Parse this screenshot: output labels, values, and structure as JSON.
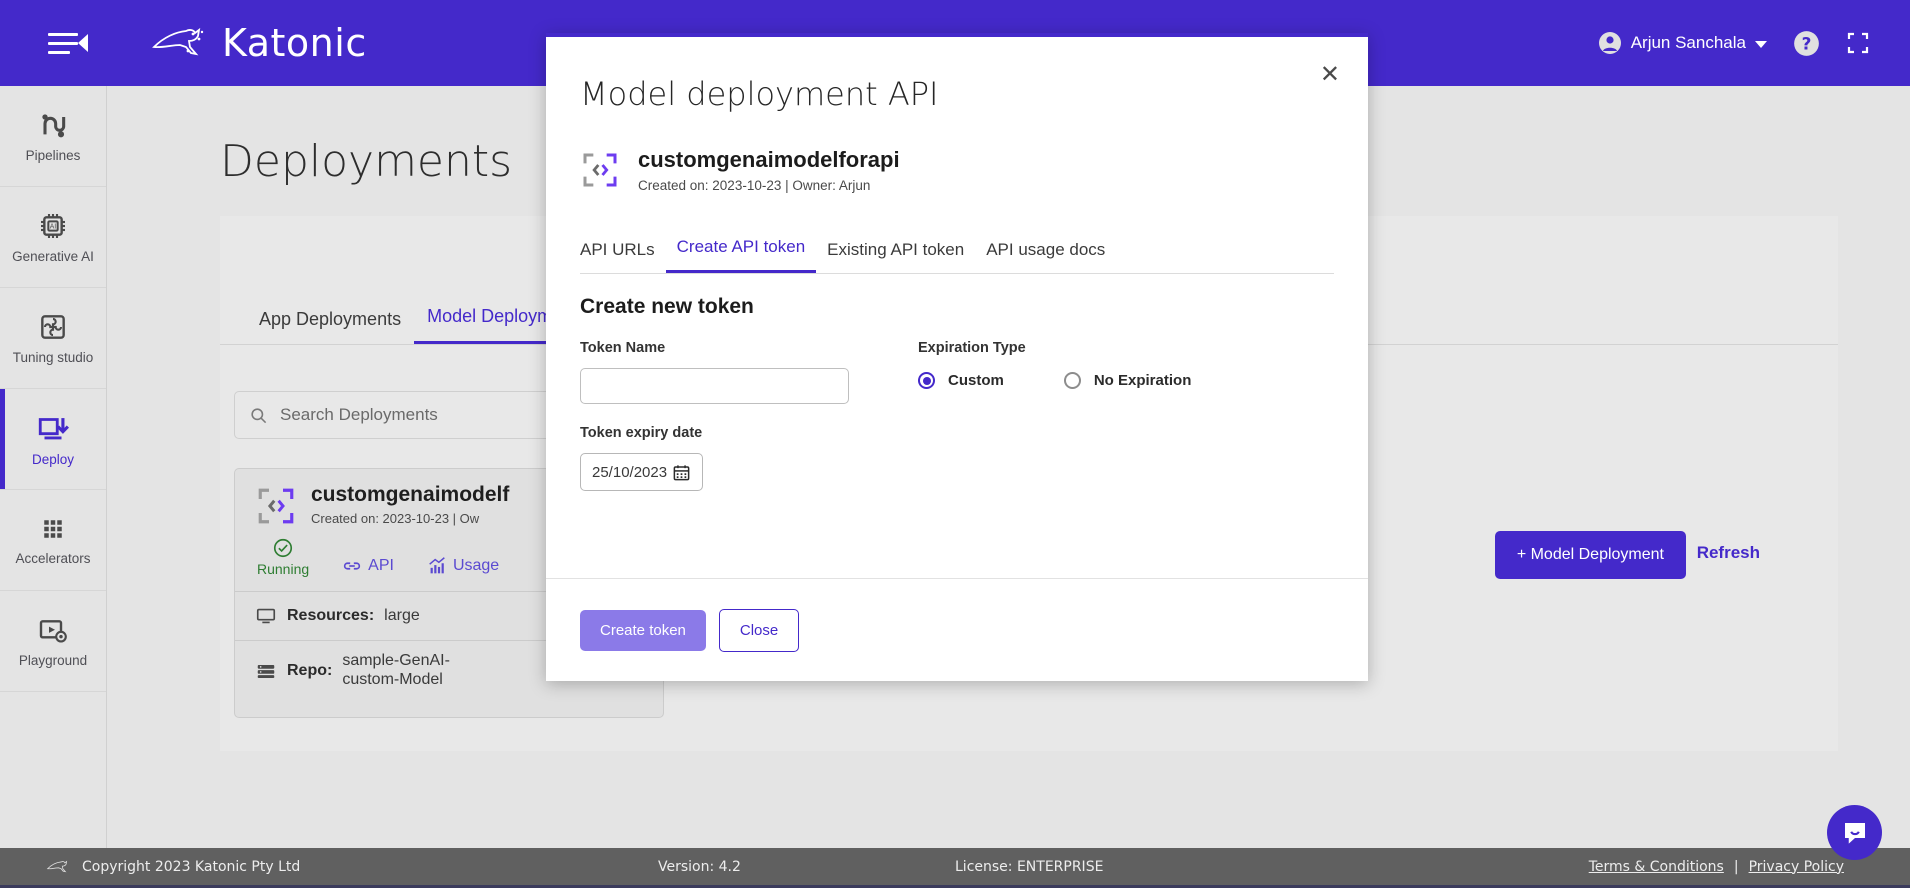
{
  "header": {
    "brand": "Katonic",
    "menu_icon": "hamburger-collapse-icon",
    "user_name": "Arjun Sanchala",
    "help_icon": "help-circle-icon",
    "fullscreen_icon": "fullscreen-icon"
  },
  "sidebar": {
    "items": [
      {
        "label": "Pipelines",
        "icon": "pipelines-icon",
        "active": false
      },
      {
        "label": "Generative AI",
        "icon": "chip-ai-icon",
        "active": false
      },
      {
        "label": "Tuning studio",
        "icon": "puzzle-icon",
        "active": false
      },
      {
        "label": "Deploy",
        "icon": "deploy-icon",
        "active": true
      },
      {
        "label": "Accelerators",
        "icon": "grid-dots-icon",
        "active": false
      },
      {
        "label": "Playground",
        "icon": "play-settings-icon",
        "active": false
      }
    ]
  },
  "page": {
    "title": "Deployments",
    "tabs": [
      {
        "label": "App Deployments",
        "active": false
      },
      {
        "label": "Model Deployments",
        "active": true
      }
    ],
    "search": {
      "placeholder": "Search Deployments",
      "value": "",
      "icon": "search-icon"
    },
    "new_deployment_button": "+ Model Deployment",
    "refresh_link": "Refresh",
    "deployment_card": {
      "icon": "code-brackets-icon",
      "name": "customgenaimodelf",
      "meta": "Created on: 2023-10-23 | Ow",
      "status": {
        "label": "Running",
        "icon": "check-circle-icon",
        "color": "#2e7d32"
      },
      "links": [
        {
          "label": "API",
          "icon": "link-icon"
        },
        {
          "label": "Usage",
          "icon": "chart-icon"
        }
      ],
      "rows": [
        {
          "icon": "monitor-icon",
          "key": "Resources:",
          "value": "large",
          "action_icon": "clipboard-code-icon"
        },
        {
          "icon": "database-icon",
          "key": "Repo:",
          "value": "sample-GenAI-custom-Model",
          "action_icon": "broadcast-icon"
        }
      ]
    }
  },
  "modal": {
    "title": "Model deployment API",
    "close_icon": "close-icon",
    "model": {
      "icon": "code-brackets-icon",
      "name": "customgenaimodelforapi",
      "meta": "Created on: 2023-10-23 | Owner: Arjun"
    },
    "tabs": [
      {
        "label": "API URLs",
        "active": false
      },
      {
        "label": "Create API token",
        "active": true
      },
      {
        "label": "Existing API token",
        "active": false
      },
      {
        "label": "API usage docs",
        "active": false
      }
    ],
    "form": {
      "heading": "Create new token",
      "token_name_label": "Token Name",
      "token_name_value": "",
      "token_name_placeholder": "",
      "expiration_label": "Expiration Type",
      "expiration_options": [
        {
          "label": "Custom",
          "selected": true
        },
        {
          "label": "No Expiration",
          "selected": false
        }
      ],
      "expiry_label": "Token expiry date",
      "expiry_value": "25/10/2023",
      "calendar_icon": "calendar-icon"
    },
    "footer": {
      "create_label": "Create token",
      "close_label": "Close"
    }
  },
  "footer": {
    "copyright": "Copyright 2023 Katonic Pty Ltd",
    "version": "Version: 4.2",
    "license": "License: ENTERPRISE",
    "terms": "Terms & Conditions",
    "separator": "|",
    "privacy": "Privacy Policy",
    "chat_icon": "chat-bubble-icon"
  },
  "colors": {
    "brand_purple": "#4429ca",
    "accent_light_purple": "#8b7ae8",
    "status_green": "#2e7d32",
    "footer_gray": "#606060"
  }
}
